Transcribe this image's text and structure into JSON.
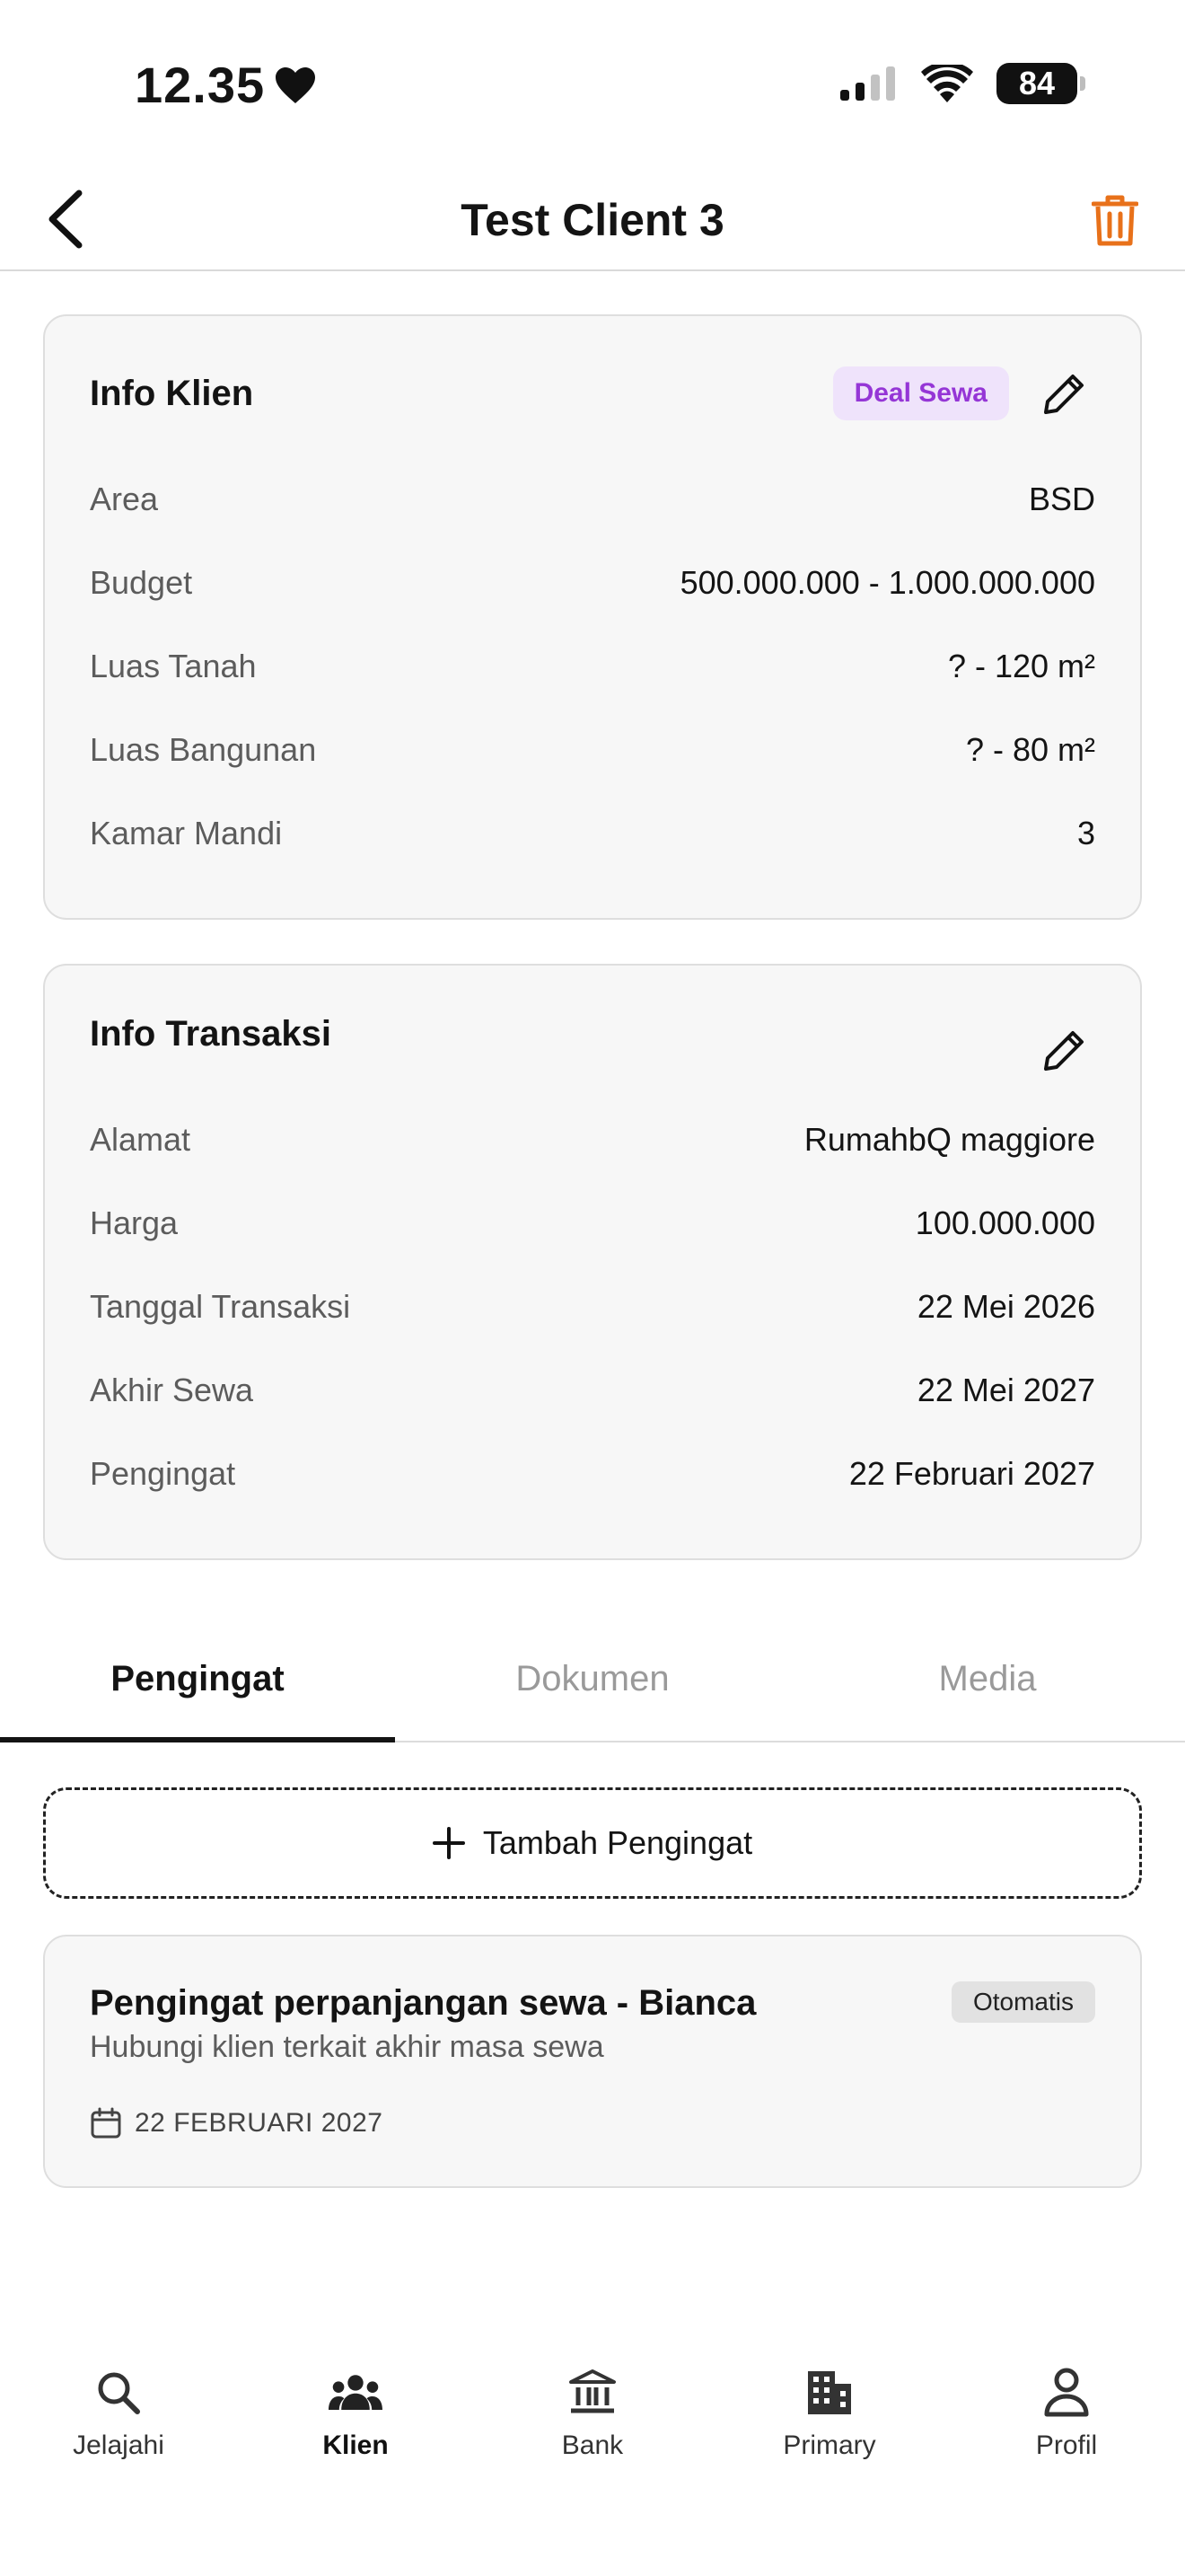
{
  "status_bar": {
    "time": "12.35",
    "battery": "84"
  },
  "header": {
    "title": "Test Client 3"
  },
  "info_klien": {
    "title": "Info Klien",
    "badge": "Deal Sewa",
    "rows": [
      {
        "label": "Area",
        "value": "BSD"
      },
      {
        "label": "Budget",
        "value": "500.000.000 - 1.000.000.000"
      },
      {
        "label": "Luas Tanah",
        "value": "? - 120 m²"
      },
      {
        "label": "Luas Bangunan",
        "value": "? - 80 m²"
      },
      {
        "label": "Kamar Mandi",
        "value": "3"
      }
    ]
  },
  "info_transaksi": {
    "title": "Info Transaksi",
    "rows": [
      {
        "label": "Alamat",
        "value": "RumahbQ maggiore"
      },
      {
        "label": "Harga",
        "value": "100.000.000"
      },
      {
        "label": "Tanggal Transaksi",
        "value": "22 Mei 2026"
      },
      {
        "label": "Akhir Sewa",
        "value": "22 Mei 2027"
      },
      {
        "label": "Pengingat",
        "value": "22 Februari 2027"
      }
    ]
  },
  "tabs": [
    "Pengingat",
    "Dokumen",
    "Media"
  ],
  "active_tab": "Pengingat",
  "add_reminder_label": "Tambah Pengingat",
  "reminders": [
    {
      "title": "Pengingat perpanjangan sewa - Bianca",
      "subtitle": "Hubungi klien terkait akhir masa sewa",
      "badge": "Otomatis",
      "date": "22 FEBRUARI 2027"
    }
  ],
  "bottom_nav": [
    {
      "label": "Jelajahi",
      "icon": "search-icon"
    },
    {
      "label": "Klien",
      "icon": "people-icon"
    },
    {
      "label": "Bank",
      "icon": "bank-icon"
    },
    {
      "label": "Primary",
      "icon": "building-icon"
    },
    {
      "label": "Profil",
      "icon": "person-icon"
    }
  ],
  "colors": {
    "accent_trash": "#e8711a",
    "badge_purple": "#9536d6",
    "badge_bg": "#efe3fb"
  }
}
